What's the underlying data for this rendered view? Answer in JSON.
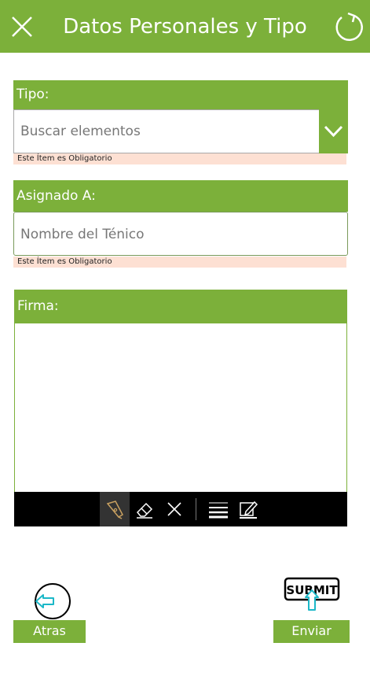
{
  "header": {
    "title": "Datos Personales y Tipo",
    "close_icon": "close-icon",
    "refresh_icon": "refresh-icon"
  },
  "tipo": {
    "label": "Tipo:",
    "placeholder": "Buscar elementos",
    "required_msg": "Este Ítem es Obligatorio"
  },
  "asignado": {
    "label": "Asignado A:",
    "placeholder": "Nombre del Ténico",
    "required_msg": "Este Ítem es Obligatorio"
  },
  "firma": {
    "label": "Firma:",
    "tools": [
      "pen-icon",
      "eraser-icon",
      "clear-icon",
      "stroke-width-icon",
      "color-edit-icon"
    ]
  },
  "footer": {
    "back_label": "Atras",
    "submit_label": "Enviar",
    "submit_image_text": "SUBMIT"
  },
  "colors": {
    "accent": "#7cb03a",
    "required_bg": "#fde0d3"
  }
}
